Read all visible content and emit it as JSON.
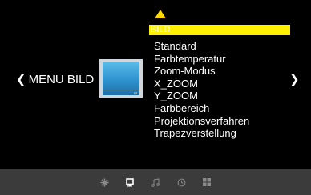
{
  "menu": {
    "header": "BILD",
    "items": [
      "Standard",
      "Farbtemperatur",
      "Zoom-Modus",
      "X_ZOOM",
      "Y_ZOOM",
      "Farbbereich",
      "Projektionsverfahren",
      "Trapezverstellung"
    ]
  },
  "nav": {
    "left_chevron": "❮",
    "left_label": "MENU BILD",
    "right_chevron": "❯"
  },
  "bottom_bar": {
    "icons": [
      "settings-icon",
      "picture-icon",
      "music-icon",
      "clock-icon",
      "grid-icon"
    ],
    "active": "picture-icon"
  },
  "colors": {
    "highlight": "#fff000",
    "arrow": "#ffd800",
    "bar": "#3b3b3b"
  }
}
